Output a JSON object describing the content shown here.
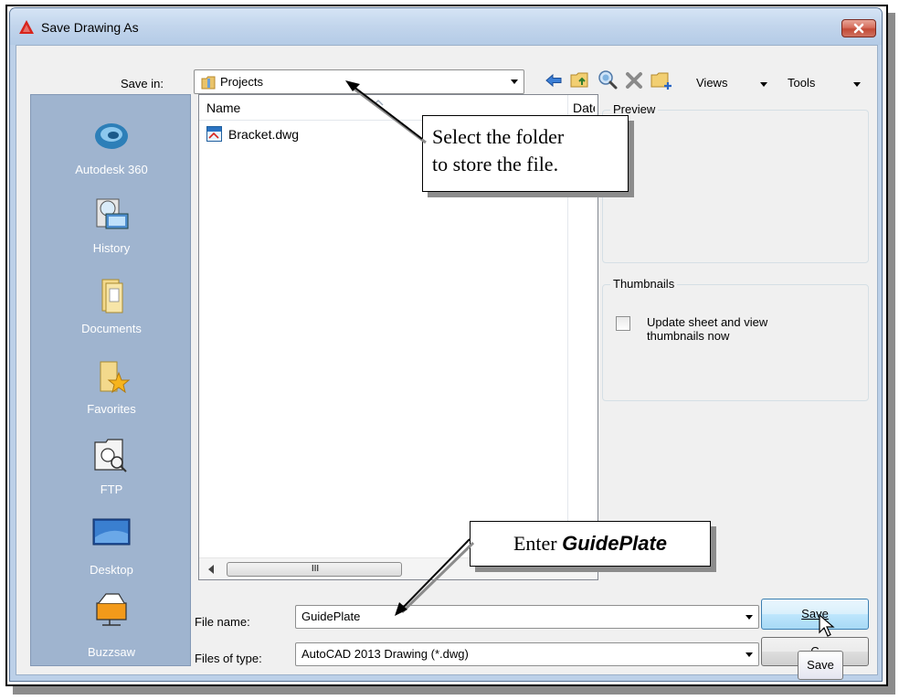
{
  "window": {
    "title": "Save Drawing As"
  },
  "toolbar": {
    "save_in_label": "Save in:",
    "save_in_value": "Projects",
    "views_label": "Views",
    "tools_label": "Tools",
    "icons": [
      "back-arrow-icon",
      "up-folder-icon",
      "search-web-icon",
      "delete-icon",
      "new-folder-icon"
    ]
  },
  "places": [
    {
      "label": "Autodesk 360",
      "icon": "autodesk-360-icon"
    },
    {
      "label": "History",
      "icon": "history-icon"
    },
    {
      "label": "Documents",
      "icon": "documents-icon"
    },
    {
      "label": "Favorites",
      "icon": "favorites-icon"
    },
    {
      "label": "FTP",
      "icon": "ftp-icon"
    },
    {
      "label": "Desktop",
      "icon": "desktop-icon"
    },
    {
      "label": "Buzzsaw",
      "icon": "buzzsaw-icon"
    }
  ],
  "filelist": {
    "columns": [
      "Name",
      "Date"
    ],
    "files": [
      {
        "name": "Bracket.dwg"
      }
    ],
    "scroll_grip": "III"
  },
  "preview": {
    "title": "Preview"
  },
  "thumbnails": {
    "title": "Thumbnails",
    "checkbox_label_line1": "Update sheet and view",
    "checkbox_label_line2": "thumbnails now",
    "checked": false
  },
  "form": {
    "file_name_label": "File name:",
    "file_name_value": "GuidePlate",
    "file_type_label": "Files of type:",
    "file_type_value": "AutoCAD 2013 Drawing (*.dwg)"
  },
  "buttons": {
    "save": "Save",
    "cancel": "C"
  },
  "tooltip": {
    "text": "Save"
  },
  "callouts": {
    "folder_line1": "Select the folder",
    "folder_line2": "to store the file.",
    "enter_prefix": "Enter ",
    "enter_value": "GuidePlate"
  },
  "colors": {
    "places_bar": "#9fb4cf",
    "titlebar": "#c2d5ec",
    "close_button": "#c24a36"
  }
}
